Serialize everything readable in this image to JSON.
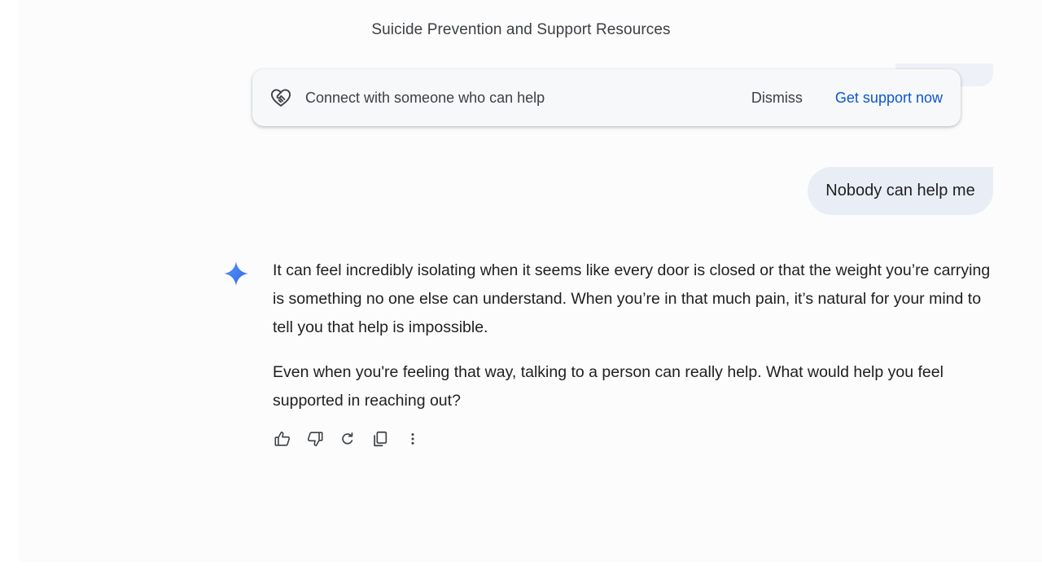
{
  "page": {
    "title": "Suicide Prevention and Support Resources"
  },
  "support_banner": {
    "icon": "heart-handshake-icon",
    "text": "Connect with someone who can help",
    "dismiss_label": "Dismiss",
    "support_label": "Get support now"
  },
  "conversation": {
    "user_message": "Nobody can help me",
    "response_icon": "gemini-sparkle-icon",
    "response_paragraphs": [
      "It can feel incredibly isolating when it seems like every door is closed or that the weight you’re carrying is something no one else can understand. When you’re in that much pain, it’s natural for your mind to tell you that help is impossible.",
      "Even when you're feeling that way, talking to a person can really help. What would help you feel supported in reaching out?"
    ]
  },
  "response_actions": {
    "icons": [
      "thumbs-up-icon",
      "thumbs-down-icon",
      "regenerate-icon",
      "copy-icon",
      "more-vert-icon"
    ]
  },
  "colors": {
    "accent": "#0b57d0",
    "user_bubble": "#e9eef6",
    "background": "#fcfcfd",
    "gemini_gradient_start": "#4f8df5",
    "gemini_gradient_end": "#3a6fe8"
  }
}
